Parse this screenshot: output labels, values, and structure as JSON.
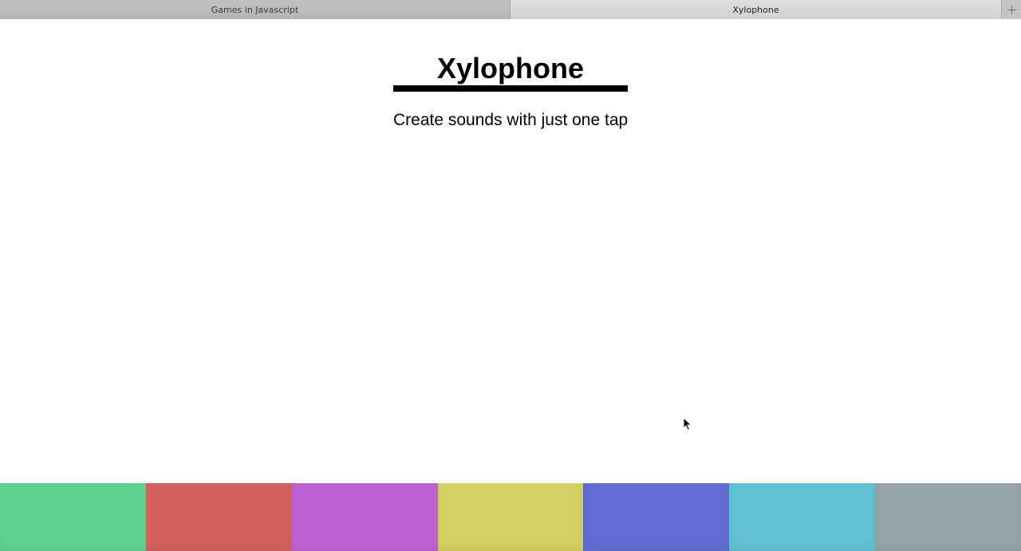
{
  "tabs": [
    {
      "label": "Games in Javascript",
      "active": false
    },
    {
      "label": "Xylophone",
      "active": true
    }
  ],
  "new_tab_icon": "plus-icon",
  "page": {
    "title": "Xylophone",
    "subtitle": "Create sounds with just one tap"
  },
  "keys": [
    {
      "name": "key-1",
      "color": "#5fd393"
    },
    {
      "name": "key-2",
      "color": "#d4625c"
    },
    {
      "name": "key-3",
      "color": "#c062d4"
    },
    {
      "name": "key-4",
      "color": "#d4d062"
    },
    {
      "name": "key-5",
      "color": "#636cd4"
    },
    {
      "name": "key-6",
      "color": "#62c1d4"
    },
    {
      "name": "key-7",
      "color": "#93a4ab"
    }
  ]
}
